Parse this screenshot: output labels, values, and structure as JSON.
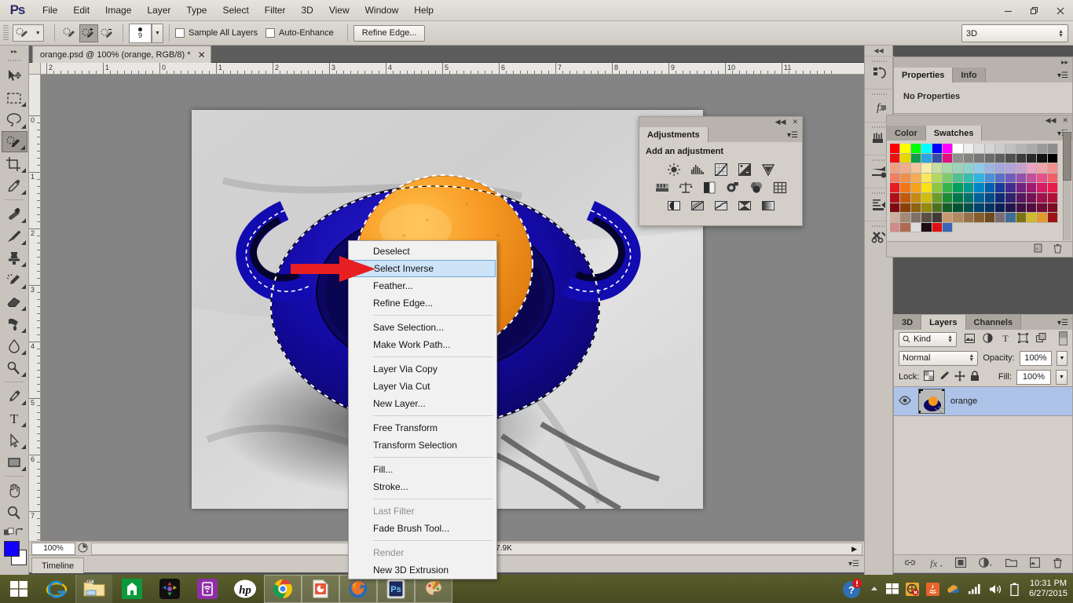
{
  "app": {
    "logo": "Ps",
    "menus": [
      "File",
      "Edit",
      "Image",
      "Layer",
      "Type",
      "Select",
      "Filter",
      "3D",
      "View",
      "Window",
      "Help"
    ],
    "window_buttons": [
      {
        "name": "minimize",
        "glyph": "—"
      },
      {
        "name": "restore",
        "glyph": "❐"
      },
      {
        "name": "close",
        "glyph": "✕"
      }
    ]
  },
  "options_bar": {
    "brush_size": "9",
    "sample_all_layers": "Sample All Layers",
    "auto_enhance": "Auto-Enhance",
    "refine_edge": "Refine Edge...",
    "workspace": "3D",
    "mode_buttons": [
      "new-selection",
      "add-to-selection",
      "subtract-from-selection"
    ],
    "active_mode": "add-to-selection"
  },
  "toolbar": {
    "tools": [
      {
        "name": "move-tool",
        "active": false,
        "has_flyout": false
      },
      {
        "name": "rectangular-marquee-tool",
        "active": false,
        "has_flyout": true
      },
      {
        "name": "lasso-tool",
        "active": false,
        "has_flyout": true
      },
      {
        "name": "quick-selection-tool",
        "active": true,
        "has_flyout": true
      },
      {
        "name": "crop-tool",
        "active": false,
        "has_flyout": true
      },
      {
        "name": "eyedropper-tool",
        "active": false,
        "has_flyout": true
      },
      {
        "name": "spot-healing-brush-tool",
        "active": false,
        "has_flyout": true
      },
      {
        "name": "brush-tool",
        "active": false,
        "has_flyout": true
      },
      {
        "name": "clone-stamp-tool",
        "active": false,
        "has_flyout": true
      },
      {
        "name": "history-brush-tool",
        "active": false,
        "has_flyout": true
      },
      {
        "name": "eraser-tool",
        "active": false,
        "has_flyout": true
      },
      {
        "name": "gradient-tool",
        "active": false,
        "has_flyout": true
      },
      {
        "name": "blur-tool",
        "active": false,
        "has_flyout": true
      },
      {
        "name": "dodge-tool",
        "active": false,
        "has_flyout": true
      },
      {
        "name": "pen-tool",
        "active": false,
        "has_flyout": true
      },
      {
        "name": "horizontal-type-tool",
        "active": false,
        "has_flyout": true
      },
      {
        "name": "path-selection-tool",
        "active": false,
        "has_flyout": true
      },
      {
        "name": "rectangle-tool",
        "active": false,
        "has_flyout": true
      },
      {
        "name": "hand-tool",
        "active": false,
        "has_flyout": false
      },
      {
        "name": "zoom-tool",
        "active": false,
        "has_flyout": false
      }
    ],
    "foreground_color": "#1200fa",
    "background_color": "#ffffff"
  },
  "document": {
    "tab_title": "orange.psd @ 100% (orange, RGB/8) *",
    "close_glyph": "✕"
  },
  "rulers": {
    "horizontal_labels": [
      "2",
      "1",
      "0",
      "1",
      "2",
      "3",
      "4",
      "5",
      "6",
      "7",
      "8",
      "9",
      "10",
      "11"
    ],
    "vertical_labels": [
      "0",
      "1",
      "2",
      "3",
      "4",
      "5",
      "6",
      "7"
    ]
  },
  "status_bar": {
    "zoom": "100%",
    "doc_info": "Doc: 957.9K/957.9K",
    "timeline_tab": "Timeline"
  },
  "context_menu": {
    "items": [
      {
        "label": "Deselect",
        "selected": false,
        "disabled": false,
        "sep_after": false
      },
      {
        "label": "Select Inverse",
        "selected": true,
        "disabled": false,
        "sep_after": false
      },
      {
        "label": "Feather...",
        "selected": false,
        "disabled": false,
        "sep_after": false
      },
      {
        "label": "Refine Edge...",
        "selected": false,
        "disabled": false,
        "sep_after": true
      },
      {
        "label": "Save Selection...",
        "selected": false,
        "disabled": false,
        "sep_after": false
      },
      {
        "label": "Make Work Path...",
        "selected": false,
        "disabled": false,
        "sep_after": true
      },
      {
        "label": "Layer Via Copy",
        "selected": false,
        "disabled": false,
        "sep_after": false
      },
      {
        "label": "Layer Via Cut",
        "selected": false,
        "disabled": false,
        "sep_after": false
      },
      {
        "label": "New Layer...",
        "selected": false,
        "disabled": false,
        "sep_after": true
      },
      {
        "label": "Free Transform",
        "selected": false,
        "disabled": false,
        "sep_after": false
      },
      {
        "label": "Transform Selection",
        "selected": false,
        "disabled": false,
        "sep_after": true
      },
      {
        "label": "Fill...",
        "selected": false,
        "disabled": false,
        "sep_after": false
      },
      {
        "label": "Stroke...",
        "selected": false,
        "disabled": false,
        "sep_after": true
      },
      {
        "label": "Last Filter",
        "selected": false,
        "disabled": true,
        "sep_after": false
      },
      {
        "label": "Fade Brush Tool...",
        "selected": false,
        "disabled": false,
        "sep_after": true
      },
      {
        "label": "Render",
        "selected": false,
        "disabled": true,
        "sep_after": false
      },
      {
        "label": "New 3D Extrusion",
        "selected": false,
        "disabled": false,
        "sep_after": false
      }
    ],
    "highlight_color": "#cde3f7"
  },
  "annotation": {
    "arrow_color": "#e81f22",
    "points_to": "Select Inverse"
  },
  "panels": {
    "properties": {
      "tabs": [
        {
          "label": "Properties",
          "active": true
        },
        {
          "label": "Info",
          "active": false
        }
      ],
      "empty_text": "No Properties"
    },
    "swatches": {
      "tabs": [
        {
          "label": "Color",
          "active": false
        },
        {
          "label": "Swatches",
          "active": true
        }
      ],
      "footer_icons": [
        "new-swatch-icon",
        "delete-swatch-icon"
      ],
      "rows": [
        [
          "#ff0000",
          "#ffff00",
          "#00ff00",
          "#00ffff",
          "#0000ff",
          "#ff00ff",
          "#ffffff",
          "#eeeeee",
          "#dddddd",
          "#d5d5d5",
          "#cccccc",
          "#c0c0c0",
          "#b5b5b5",
          "#aaaaaa",
          "#9a9a9a",
          "#8e8e8e"
        ],
        [
          "#ee1111",
          "#e8d800",
          "#0f9d4a",
          "#2aa5e0",
          "#3a4fa8",
          "#e0107f",
          "#8f8f8f",
          "#848484",
          "#787878",
          "#6c6c6c",
          "#5f5f5f",
          "#4f4f4f",
          "#3c3c3c",
          "#2a2a2a",
          "#141414",
          "#000000"
        ],
        [
          "#f0a184",
          "#f0ad8c",
          "#f3c49c",
          "#f7eda8",
          "#c4e0a0",
          "#a8d9a8",
          "#9bd4bb",
          "#8ed2cf",
          "#8fcbe8",
          "#9cb6e0",
          "#a3a8dd",
          "#b0a3d6",
          "#c4a1cf",
          "#eaa2c4",
          "#f0a3a8",
          "#f09090"
        ],
        [
          "#ef7f5f",
          "#f08f4c",
          "#f4ab55",
          "#f7e85c",
          "#b2d95e",
          "#7ecb6f",
          "#4fc08f",
          "#37bdb0",
          "#2fb4e5",
          "#4b90d8",
          "#5a6fcb",
          "#6f5cbd",
          "#9350ad",
          "#c44f9a",
          "#e94f8c",
          "#ef5f66"
        ],
        [
          "#e81c24",
          "#f07818",
          "#f5a21c",
          "#f7e215",
          "#8fc740",
          "#34b44a",
          "#00a160",
          "#009a8e",
          "#0086c8",
          "#0061b0",
          "#1a3a9c",
          "#442b90",
          "#72227f",
          "#a01a73",
          "#d81b68",
          "#e81b4a"
        ],
        [
          "#b01018",
          "#c05a10",
          "#c78a14",
          "#cfbe10",
          "#6d9b2c",
          "#1c8c36",
          "#00794a",
          "#00746b",
          "#00649a",
          "#004a87",
          "#102a77",
          "#31206e",
          "#551760",
          "#771257",
          "#a21150",
          "#b01037"
        ],
        [
          "#7d0c12",
          "#8a3f0b",
          "#8f620e",
          "#97890b",
          "#4e6f1f",
          "#125f26",
          "#005434",
          "#00504b",
          "#00456e",
          "#003361",
          "#0a1d55",
          "#22154f",
          "#3c1045",
          "#550c3e",
          "#730b39",
          "#7d0b27"
        ],
        [
          "#cdb09c",
          "#a48878",
          "#7f7167",
          "#5a4e47",
          "#413933",
          "#c79a6c",
          "#b08a5c",
          "#96714a",
          "#8a5d2c",
          "#6e4a1f",
          "#7b6b74",
          "#3d6e94",
          "#7a7218",
          "#cfb92c",
          "#e29a2c",
          "#9c1414"
        ],
        [
          "#d08a8a",
          "#b06a50",
          "#dcdcdc",
          "#1c0a14",
          "#e01010",
          "#3a64b4"
        ]
      ]
    },
    "adjustments": {
      "title": "Adjustments",
      "subtitle": "Add an adjustment",
      "icons": [
        [
          "brightness-contrast-icon",
          "levels-icon",
          "curves-icon",
          "exposure-icon",
          "vibrance-icon"
        ],
        [
          "hue-saturation-icon",
          "color-balance-icon",
          "black-white-icon",
          "photo-filter-icon",
          "channel-mixer-icon",
          "color-lookup-icon"
        ],
        [
          "invert-icon",
          "posterize-icon",
          "threshold-icon",
          "selective-color-icon",
          "gradient-map-icon"
        ]
      ],
      "collapse_glyph": "◀◀",
      "close_glyph": "✕"
    },
    "layers": {
      "tabs": [
        {
          "label": "3D",
          "active": false
        },
        {
          "label": "Layers",
          "active": true
        },
        {
          "label": "Channels",
          "active": false
        }
      ],
      "filter_label": "Kind",
      "filter_icons": [
        "pixel-layers-icon",
        "adjustment-layers-icon",
        "type-layers-icon",
        "shape-layers-icon",
        "smart-objects-icon"
      ],
      "blend_mode": "Normal",
      "opacity_label": "Opacity:",
      "opacity_value": "100%",
      "lock_label": "Lock:",
      "lock_icons": [
        "lock-transparent-pixels-icon",
        "lock-image-pixels-icon",
        "lock-position-icon",
        "lock-all-icon"
      ],
      "fill_label": "Fill:",
      "fill_value": "100%",
      "layer_rows": [
        {
          "name": "orange",
          "visible": true,
          "selected": true
        }
      ],
      "footer_icons": [
        "link-layers-icon",
        "layer-style-icon",
        "layer-mask-icon",
        "new-fill-adjustment-icon",
        "new-group-icon",
        "new-layer-icon",
        "delete-layer-icon"
      ],
      "selection_color": "#aec3e8"
    },
    "rail_icons": [
      "history-icon",
      "layer-comps-icon",
      "brush-presets-icon",
      "clone-source-icon",
      "paragraph-styles-icon",
      "tool-presets-icon"
    ]
  },
  "taskbar": {
    "start": "windows-start-icon",
    "apps": [
      {
        "name": "internet-explorer-icon",
        "pinned": false,
        "running": false
      },
      {
        "name": "file-explorer-icon",
        "pinned": true,
        "running": false
      },
      {
        "name": "windows-store-icon",
        "pinned": false,
        "running": false
      },
      {
        "name": "apps-folder-icon",
        "pinned": false,
        "running": false
      },
      {
        "name": "screen-cast-icon",
        "pinned": false,
        "running": false
      },
      {
        "name": "hp-support-icon",
        "pinned": false,
        "running": false
      },
      {
        "name": "google-chrome-icon",
        "pinned": false,
        "running": true
      },
      {
        "name": "powerpoint-icon",
        "pinned": false,
        "running": true
      },
      {
        "name": "mozilla-firefox-icon",
        "pinned": false,
        "running": true
      },
      {
        "name": "photoshop-icon",
        "pinned": false,
        "running": true
      },
      {
        "name": "paint-icon",
        "pinned": false,
        "running": true
      }
    ],
    "tray": {
      "action_center": "help-alert-icon",
      "show_hidden": "show-hidden-icons-icon",
      "icons": [
        "windows-flag-icon",
        "security-alert-icon",
        "java-update-icon",
        "onedrive-icon",
        "network-signal-icon",
        "volume-icon",
        "battery-icon"
      ],
      "time": "10:31 PM",
      "date": "6/27/2015"
    }
  }
}
